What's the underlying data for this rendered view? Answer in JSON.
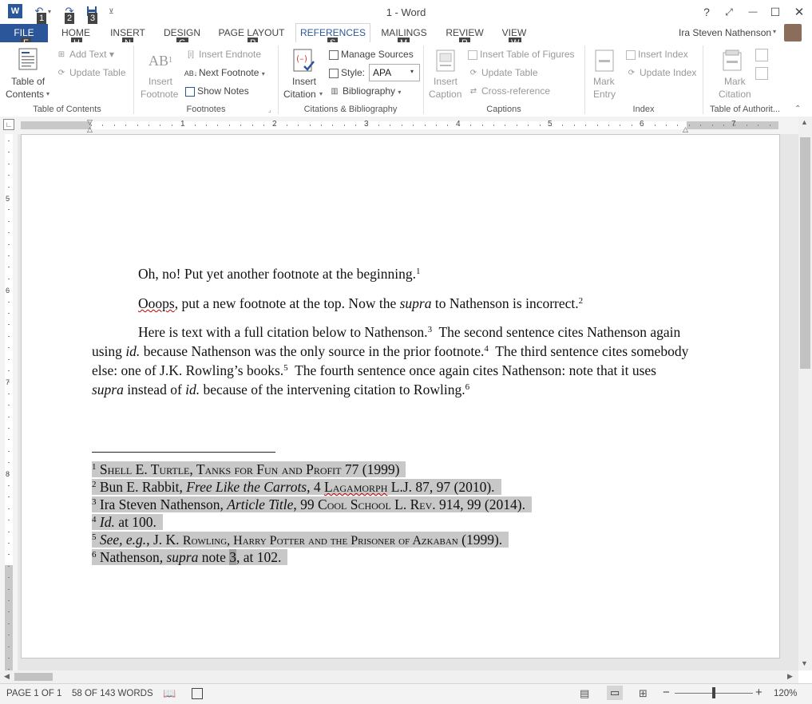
{
  "window": {
    "title": "1 - Word"
  },
  "qat": {
    "keytips": [
      "1",
      "2",
      "3"
    ],
    "icons": [
      "word-logo-icon",
      "undo-icon",
      "redo-icon",
      "save-icon",
      "customize-qat-icon"
    ]
  },
  "window_controls": {
    "help": "?",
    "restore_ribbon": "⤢",
    "minimize": "—",
    "maximize": "☐",
    "close": "✕"
  },
  "tabs": [
    {
      "label": "FILE",
      "keytip": "F"
    },
    {
      "label": "HOME",
      "keytip": "H"
    },
    {
      "label": "INSERT",
      "keytip": "N"
    },
    {
      "label": "DESIGN",
      "keytip": "G"
    },
    {
      "label": "PAGE LAYOUT",
      "keytip": "P"
    },
    {
      "label": "REFERENCES",
      "keytip": "S"
    },
    {
      "label": "MAILINGS",
      "keytip": "M"
    },
    {
      "label": "REVIEW",
      "keytip": "R"
    },
    {
      "label": "VIEW",
      "keytip": "W"
    }
  ],
  "user": {
    "name": "Ira Steven Nathenson"
  },
  "ribbon": {
    "toc": {
      "table_of_contents_1": "Table of",
      "table_of_contents_2": "Contents",
      "add_text": "Add Text",
      "update_table": "Update Table",
      "group": "Table of Contents"
    },
    "footnotes": {
      "insert_footnote_1": "Insert",
      "insert_footnote_2": "Footnote",
      "insert_endnote": "Insert Endnote",
      "next_footnote": "Next Footnote",
      "show_notes": "Show Notes",
      "group": "Footnotes"
    },
    "citations": {
      "insert_citation_1": "Insert",
      "insert_citation_2": "Citation",
      "manage_sources": "Manage Sources",
      "style_label": "Style:",
      "style_value": "APA",
      "bibliography": "Bibliography",
      "group": "Citations & Bibliography"
    },
    "captions": {
      "insert_caption_1": "Insert",
      "insert_caption_2": "Caption",
      "insert_table_of_figures": "Insert Table of Figures",
      "update_table": "Update Table",
      "cross_reference": "Cross-reference",
      "group": "Captions"
    },
    "index": {
      "mark_entry_1": "Mark",
      "mark_entry_2": "Entry",
      "insert_index": "Insert Index",
      "update_index": "Update Index",
      "group": "Index"
    },
    "toa": {
      "mark_citation_1": "Mark",
      "mark_citation_2": "Citation",
      "group": "Table of Authorit..."
    }
  },
  "ruler": {
    "numbers": [
      "1",
      "2",
      "3",
      "4",
      "5",
      "6",
      "7"
    ],
    "v_numbers": [
      "5",
      "6",
      "7",
      "8"
    ]
  },
  "document": {
    "p1": {
      "text": "Oh, no! Put yet another footnote at the beginning.",
      "ref": "1"
    },
    "p2": {
      "word": "Ooops",
      "a": ", put a new footnote at the top. Now the ",
      "italic": "supra",
      "b": " to Nathenson is incorrect.",
      "ref": "2"
    },
    "p3": {
      "s1": "Here is text with a full citation below to Nathenson.",
      "r3": "3",
      "s2a": "  The second sentence cites Nathenson again using ",
      "s2i": "id.",
      "s2b": " because Nathenson was the only source in the prior footnote.",
      "r4": "4",
      "s3": "  The third sentence cites somebody else: one of J.K. Rowling’s books.",
      "r5": "5",
      "s4a": "  The fourth sentence once again cites Nathenson: note that it uses ",
      "s4i": "supra",
      "s4b": " instead of ",
      "s4i2": "id.",
      "s4c": " because of the intervening citation to Rowling.",
      "r6": "6"
    },
    "footnotes": {
      "f1": {
        "num": "1",
        "sc": "Shell E. Turtle, Tanks for Fun and Profit",
        "rest": " 77 (1999)"
      },
      "f2": {
        "num": "2",
        "a": " Bun E. Rabbit, ",
        "i": "Free Like the Carrots",
        "b": ", 4 ",
        "sc": "Lagamorph",
        "c": " L.J. 87, 97 (2010)."
      },
      "f3": {
        "num": "3",
        "a": " Ira Steven Nathenson, ",
        "i": "Article Title",
        "b": ", 99 ",
        "sc": "Cool School L. Rev.",
        "c": " 914, 99 (2014)."
      },
      "f4": {
        "num": "4",
        "i": "Id.",
        "a": " at 100."
      },
      "f5": {
        "num": "5",
        "i": "See, e.g.",
        "a": ", J. K. ",
        "sc": "Rowling, Harry Potter and the Prisoner of Azkaban",
        "b": " (1999)."
      },
      "f6": {
        "num": "6",
        "a": " Nathenson",
        "i": ", supra",
        "b": " note ",
        "hl": "3",
        "c": ", at 102."
      }
    }
  },
  "status": {
    "page": "PAGE 1 OF 1",
    "words": "58 OF 143 WORDS",
    "zoom": "120%"
  },
  "colors": {
    "accent": "#2b579a",
    "selection": "#c8c8c8"
  }
}
